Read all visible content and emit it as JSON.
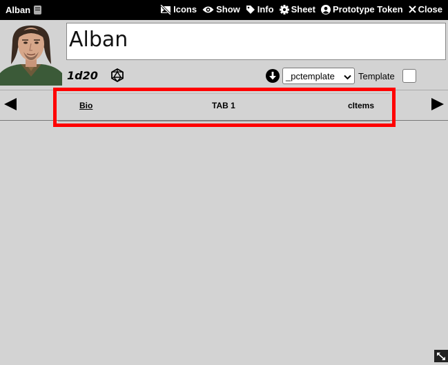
{
  "window": {
    "title": "Alban"
  },
  "header_buttons": [
    {
      "label": "Icons",
      "icon": "no-image-icon"
    },
    {
      "label": "Show",
      "icon": "eye-icon"
    },
    {
      "label": "Info",
      "icon": "tag-icon"
    },
    {
      "label": "Sheet",
      "icon": "gear-icon"
    },
    {
      "label": "Prototype Token",
      "icon": "user-circle-icon"
    },
    {
      "label": "Close",
      "icon": "close-icon"
    }
  ],
  "name": {
    "value": "Alban"
  },
  "formula": "1d20",
  "template": {
    "selected": "_pctemplate",
    "label": "Template",
    "checked": false
  },
  "tabs": [
    {
      "label": "Bio",
      "active": true
    },
    {
      "label": "TAB 1",
      "active": false
    },
    {
      "label": "cItems",
      "active": false
    }
  ],
  "colors": {
    "highlight": "#ff0000",
    "header_bg": "#000000",
    "body_bg": "#d3d3d3"
  }
}
